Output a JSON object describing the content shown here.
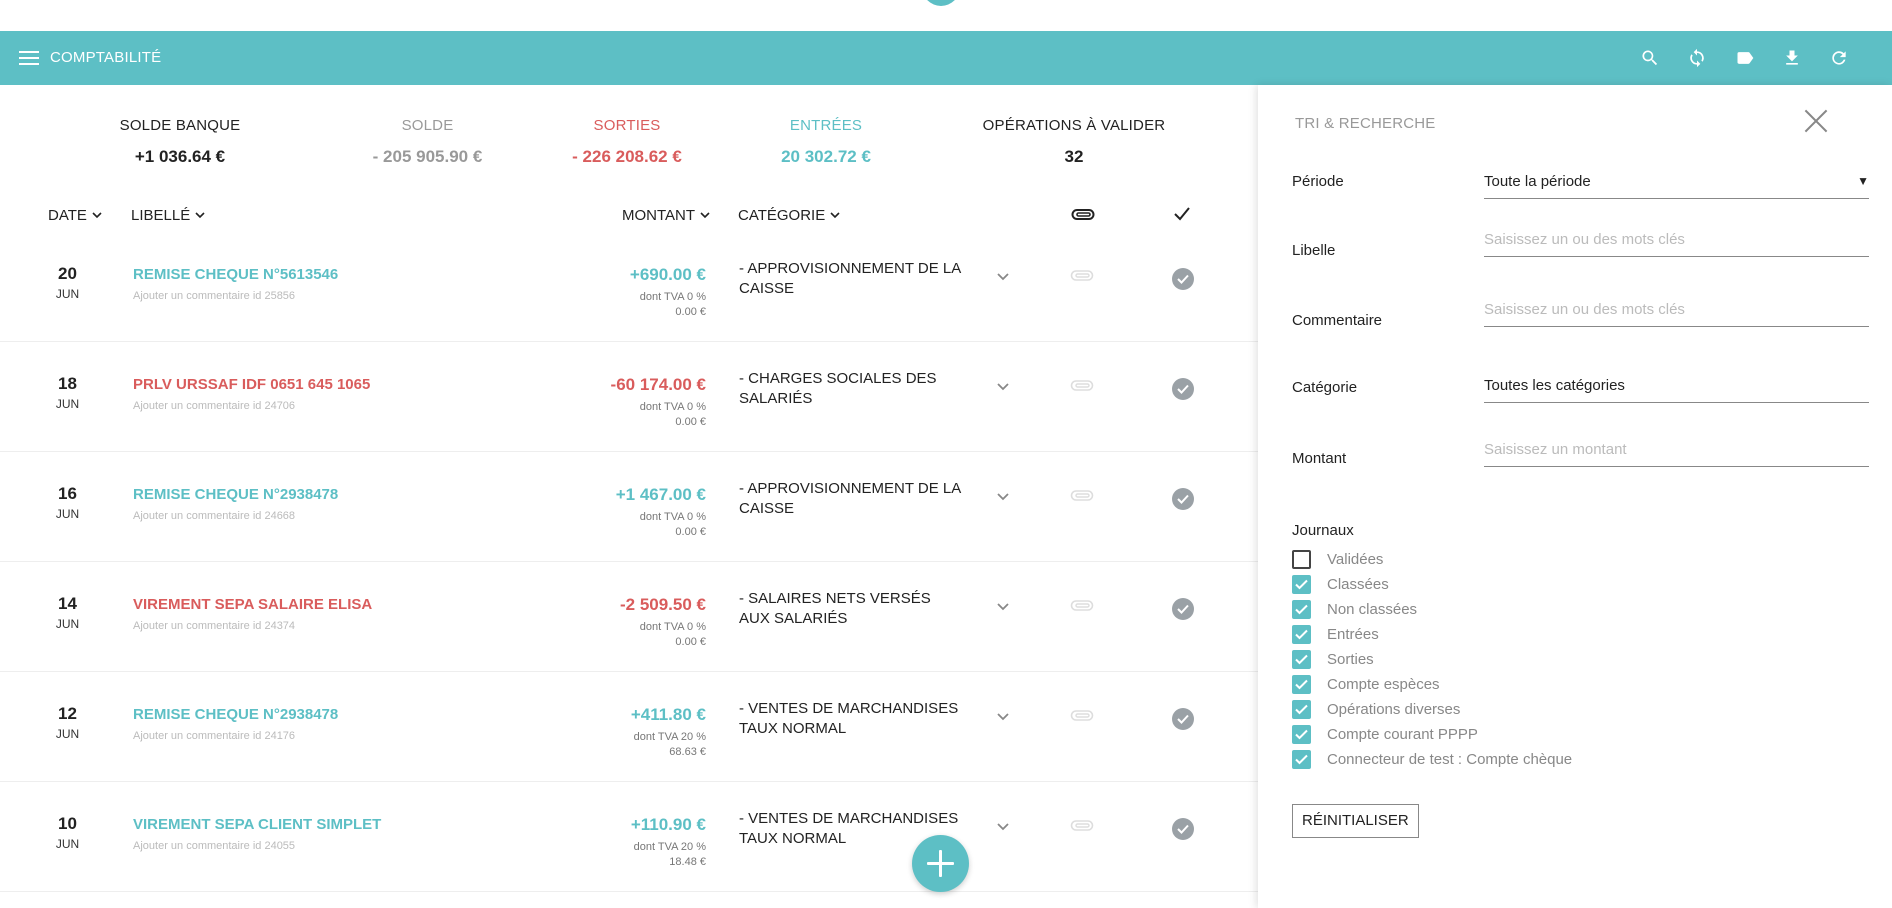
{
  "app": {
    "title": "COMPTABILITÉ"
  },
  "toolbar": {
    "icons": [
      "search-icon",
      "sync-icon",
      "label-icon",
      "download-icon",
      "refresh-icon"
    ]
  },
  "summary": {
    "solde_banque": {
      "label": "SOLDE BANQUE",
      "value": "+1 036.64 €"
    },
    "solde": {
      "label": "SOLDE",
      "value": "- 205 905.90 €"
    },
    "sorties": {
      "label": "SORTIES",
      "value": "- 226 208.62 €"
    },
    "entrees": {
      "label": "ENTRÉES",
      "value": "20 302.72 €"
    },
    "operations": {
      "label": "OPÉRATIONS À VALIDER",
      "value": "32"
    }
  },
  "columns": {
    "date": "DATE",
    "libelle": "LIBELLÉ",
    "montant": "MONTANT",
    "categorie": "CATÉGORIE"
  },
  "transactions": [
    {
      "day": "20",
      "month": "JUN",
      "label": "REMISE CHEQUE N°5613546",
      "comment": "Ajouter un commentaire id 25856",
      "amount": "+690.00 €",
      "tva_line1": "dont TVA 0 %",
      "tva_line2": "0.00 €",
      "category": "- APPROVISIONNEMENT DE LA CAISSE",
      "direction": "in"
    },
    {
      "day": "18",
      "month": "JUN",
      "label": "PRLV URSSAF IDF 0651 645 1065",
      "comment": "Ajouter un commentaire id 24706",
      "amount": "-60 174.00 €",
      "tva_line1": "dont TVA 0 %",
      "tva_line2": "0.00 €",
      "category": "- CHARGES SOCIALES DES SALARIÉS",
      "direction": "out"
    },
    {
      "day": "16",
      "month": "JUN",
      "label": "REMISE CHEQUE N°2938478",
      "comment": "Ajouter un commentaire id 24668",
      "amount": "+1 467.00 €",
      "tva_line1": "dont TVA 0 %",
      "tva_line2": "0.00 €",
      "category": "- APPROVISIONNEMENT DE LA CAISSE",
      "direction": "in"
    },
    {
      "day": "14",
      "month": "JUN",
      "label": "VIREMENT SEPA SALAIRE ELISA",
      "comment": "Ajouter un commentaire id 24374",
      "amount": "-2 509.50 €",
      "tva_line1": "dont TVA 0 %",
      "tva_line2": "0.00 €",
      "category": "- SALAIRES NETS VERSÉS AUX SALARIÉS",
      "direction": "out"
    },
    {
      "day": "12",
      "month": "JUN",
      "label": "REMISE CHEQUE N°2938478",
      "comment": "Ajouter un commentaire id 24176",
      "amount": "+411.80 €",
      "tva_line1": "dont TVA 20 %",
      "tva_line2": "68.63 €",
      "category": "- VENTES DE MARCHANDISES TAUX NORMAL",
      "direction": "in"
    },
    {
      "day": "10",
      "month": "JUN",
      "label": "VIREMENT SEPA CLIENT SIMPLET",
      "comment": "Ajouter un commentaire id 24055",
      "amount": "+110.90 €",
      "tva_line1": "dont TVA 20 %",
      "tva_line2": "18.48 €",
      "category": "- VENTES DE MARCHANDISES TAUX NORMAL",
      "direction": "in"
    }
  ],
  "panel": {
    "title": "TRI & RECHERCHE",
    "periode": {
      "label": "Période",
      "value": "Toute la période",
      "caret": "▼"
    },
    "libelle": {
      "label": "Libelle",
      "placeholder": "Saisissez un ou des mots clés"
    },
    "commentaire": {
      "label": "Commentaire",
      "placeholder": "Saisissez un ou des mots clés"
    },
    "categorie": {
      "label": "Catégorie",
      "value": "Toutes les catégories"
    },
    "montant": {
      "label": "Montant",
      "placeholder": "Saisissez un montant"
    },
    "journaux_title": "Journaux",
    "journaux": [
      {
        "label": "Validées",
        "checked": false
      },
      {
        "label": "Classées",
        "checked": true
      },
      {
        "label": "Non classées",
        "checked": true
      },
      {
        "label": "Entrées",
        "checked": true
      },
      {
        "label": "Sorties",
        "checked": true
      },
      {
        "label": "Compte espèces",
        "checked": true
      },
      {
        "label": "Opérations diverses",
        "checked": true
      },
      {
        "label": "Compte courant PPPP",
        "checked": true
      },
      {
        "label": "Connecteur de test : Compte chèque",
        "checked": true
      }
    ],
    "reset_label": "RÉINITIALISER"
  },
  "colors": {
    "accent": "#5dbfc5",
    "negative": "#d95c5c",
    "muted": "#999999",
    "check": "#9aa1a6"
  }
}
